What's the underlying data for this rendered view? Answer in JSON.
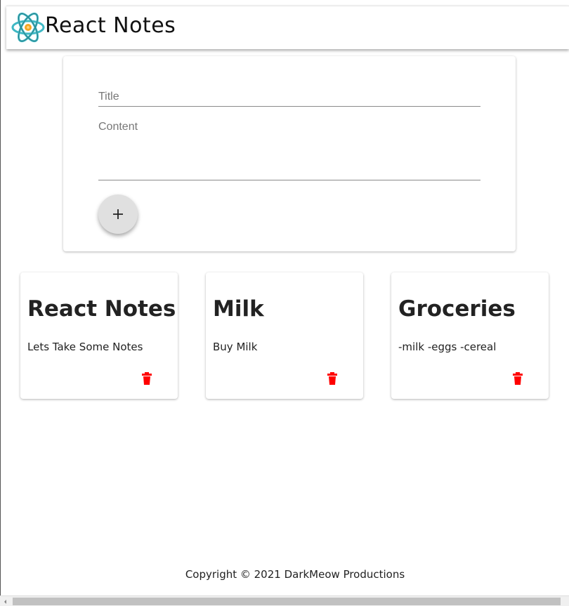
{
  "header": {
    "title": "React Notes",
    "logo_icon": "atom-logo-icon"
  },
  "form": {
    "title_placeholder": "Title",
    "content_placeholder": "Content",
    "add_button_icon": "plus-icon"
  },
  "notes": [
    {
      "title": "React Notes",
      "content": "Lets Take Some Notes"
    },
    {
      "title": "Milk",
      "content": "Buy Milk"
    },
    {
      "title": "Groceries",
      "content": "-milk -eggs -cereal"
    }
  ],
  "footer": {
    "copyright": "Copyright © 2021 DarkMeow Productions"
  },
  "colors": {
    "delete_icon": "#ff0000",
    "logo_teal": "#3fb8c4",
    "logo_orange": "#f5a623",
    "fab_background": "#e0e0e0"
  }
}
